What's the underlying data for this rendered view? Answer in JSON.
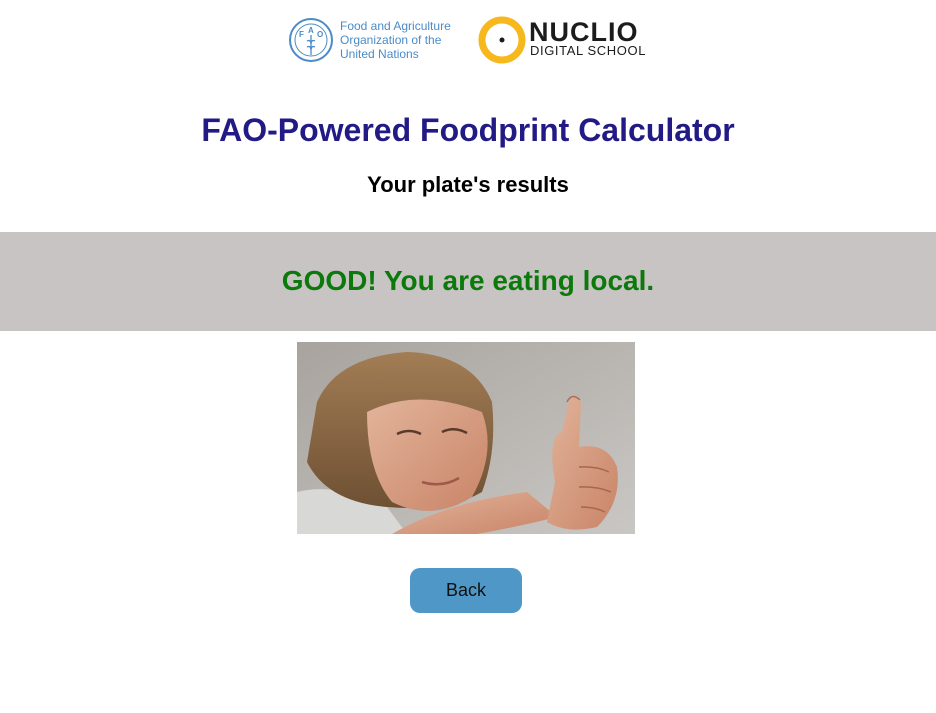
{
  "header": {
    "fao_logo_text": "Food and Agriculture\nOrganization of the\nUnited Nations",
    "fao_logo_letters": "FAO",
    "nuclio_logo_word": "NUCLIO",
    "nuclio_logo_sub": "DIGITAL SCHOOL"
  },
  "main": {
    "title": "FAO-Powered Foodprint Calculator",
    "subtitle": "Your plate's results",
    "result_message": "GOOD! You are eating local."
  },
  "actions": {
    "back_label": "Back"
  },
  "colors": {
    "title": "#221a85",
    "result": "#0b7a0b",
    "banner_bg": "#c9c4c4",
    "button_bg": "#4f97c6",
    "fao_blue": "#4a8bc8",
    "nuclio_yellow": "#f6b81c"
  }
}
